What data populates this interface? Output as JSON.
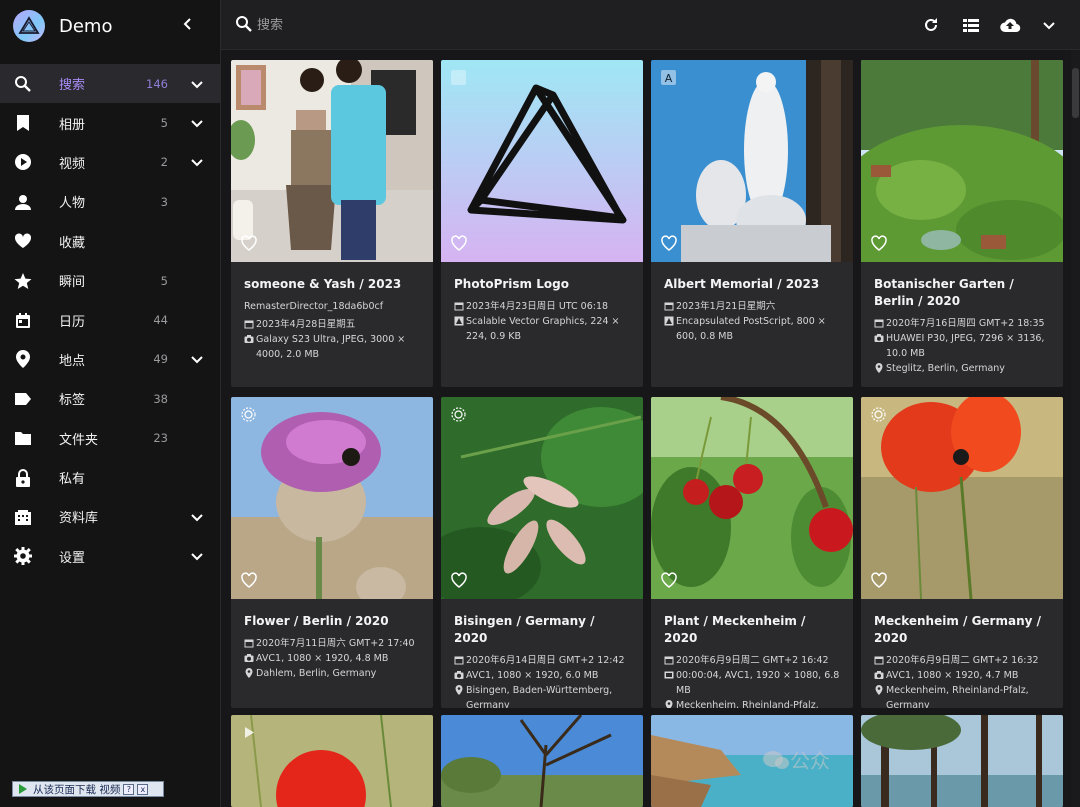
{
  "app": {
    "title": "Demo"
  },
  "sidebar": {
    "items": [
      {
        "label": "搜索",
        "count": "146",
        "icon": "search-icon",
        "chevron": true,
        "active": true
      },
      {
        "label": "相册",
        "count": "5",
        "icon": "bookmark-icon",
        "chevron": true
      },
      {
        "label": "视频",
        "count": "2",
        "icon": "play-circle-icon",
        "chevron": true
      },
      {
        "label": "人物",
        "count": "3",
        "icon": "person-icon",
        "chevron": false
      },
      {
        "label": "收藏",
        "count": "",
        "icon": "heart-icon",
        "chevron": false
      },
      {
        "label": "瞬间",
        "count": "5",
        "icon": "star-icon",
        "chevron": false
      },
      {
        "label": "日历",
        "count": "44",
        "icon": "calendar-icon",
        "chevron": false
      },
      {
        "label": "地点",
        "count": "49",
        "icon": "location-pin-icon",
        "chevron": true
      },
      {
        "label": "标签",
        "count": "38",
        "icon": "tag-icon",
        "chevron": false
      },
      {
        "label": "文件夹",
        "count": "23",
        "icon": "folder-icon",
        "chevron": false
      },
      {
        "label": "私有",
        "count": "",
        "icon": "lock-icon",
        "chevron": false
      },
      {
        "label": "资料库",
        "count": "",
        "icon": "library-icon",
        "chevron": true
      },
      {
        "label": "设置",
        "count": "",
        "icon": "gear-icon",
        "chevron": true
      }
    ]
  },
  "search": {
    "placeholder": "搜索"
  },
  "video_bar": {
    "label": "从该页面下载 视频",
    "help": "?",
    "close": "x"
  },
  "watermark": "公众",
  "cards": [
    {
      "title": "someone & Yash / 2023",
      "lines": [
        {
          "icon": "",
          "text": "RemasterDirector_18da6b0cf"
        },
        {
          "icon": "calendar-icon",
          "text": "2023年4月28日星期五"
        },
        {
          "icon": "camera-icon",
          "text": "Galaxy S23 Ultra, JPEG, 3000 × 4000, 2.0 MB"
        }
      ]
    },
    {
      "title": "PhotoPrism Logo",
      "lines": [
        {
          "icon": "calendar-icon",
          "text": "2023年4月23日周日 UTC 06:18"
        },
        {
          "icon": "vector-icon",
          "text": "Scalable Vector Graphics, 224 × 224, 0.9 KB"
        }
      ]
    },
    {
      "title": "Albert Memorial / 2023",
      "lines": [
        {
          "icon": "calendar-icon",
          "text": "2023年1月21日星期六"
        },
        {
          "icon": "vector-icon",
          "text": "Encapsulated PostScript, 800 × 600, 0.8 MB"
        }
      ]
    },
    {
      "title": "Botanischer Garten / Berlin / 2020",
      "lines": [
        {
          "icon": "calendar-icon",
          "text": "2020年7月16日周四 GMT+2 18:35"
        },
        {
          "icon": "camera-icon",
          "text": "HUAWEI P30, JPEG, 7296 × 3136, 10.0 MB"
        },
        {
          "icon": "location-pin-icon",
          "text": "Steglitz, Berlin, Germany"
        }
      ]
    },
    {
      "title": "Flower / Berlin / 2020",
      "lines": [
        {
          "icon": "calendar-icon",
          "text": "2020年7月11日周六 GMT+2 17:40"
        },
        {
          "icon": "camera-icon",
          "text": "AVC1, 1080 × 1920, 4.8 MB"
        },
        {
          "icon": "location-pin-icon",
          "text": "Dahlem, Berlin, Germany"
        }
      ]
    },
    {
      "title": "Bisingen / Germany / 2020",
      "lines": [
        {
          "icon": "calendar-icon",
          "text": "2020年6月14日周日 GMT+2 12:42"
        },
        {
          "icon": "camera-icon",
          "text": "AVC1, 1080 × 1920, 6.0 MB"
        },
        {
          "icon": "location-pin-icon",
          "text": "Bisingen, Baden-Württemberg, Germany"
        }
      ]
    },
    {
      "title": "Plant / Meckenheim / 2020",
      "lines": [
        {
          "icon": "calendar-icon",
          "text": "2020年6月9日周二 GMT+2 16:42"
        },
        {
          "icon": "film-icon",
          "text": "00:00:04, AVC1, 1920 × 1080, 6.8 MB"
        },
        {
          "icon": "location-pin-icon",
          "text": "Meckenheim, Rheinland-Pfalz, Germany"
        }
      ]
    },
    {
      "title": "Meckenheim / Germany / 2020",
      "lines": [
        {
          "icon": "calendar-icon",
          "text": "2020年6月9日周二 GMT+2 16:32"
        },
        {
          "icon": "camera-icon",
          "text": "AVC1, 1080 × 1920, 4.7 MB"
        },
        {
          "icon": "location-pin-icon",
          "text": "Meckenheim, Rheinland-Pfalz, Germany"
        }
      ]
    }
  ]
}
